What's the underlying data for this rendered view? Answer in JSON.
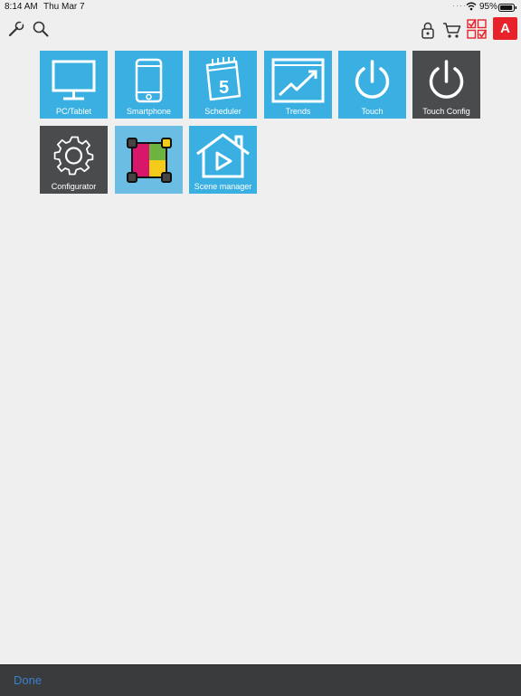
{
  "status_bar": {
    "time": "8:14 AM",
    "date": "Thu Mar 7",
    "dots": "····",
    "battery_text": "95%",
    "battery_level": 0.95,
    "wifi_icon": "wifi-icon",
    "battery_icon": "battery-icon"
  },
  "toolbar": {
    "left_icons": [
      "wrench-icon",
      "search-icon"
    ],
    "right_icons": [
      "lock-icon",
      "cart-icon",
      "checklist-icon",
      "account-icon"
    ],
    "account_letter": "A"
  },
  "tiles": [
    {
      "label": "PC/Tablet",
      "icon": "monitor-icon"
    },
    {
      "label": "Smartphone",
      "icon": "smartphone-icon"
    },
    {
      "label": "Scheduler",
      "icon": "calendar-icon",
      "badge": "5"
    },
    {
      "label": "Trends",
      "icon": "trend-chart-icon"
    },
    {
      "label": "Touch",
      "icon": "power-icon"
    },
    {
      "label": "Touch Config",
      "icon": "power-icon"
    },
    {
      "label": "Configurator",
      "icon": "gear-icon"
    },
    {
      "label": "",
      "icon": "color-grid-icon"
    },
    {
      "label": "Scene manager",
      "icon": "home-play-icon"
    }
  ],
  "bottom_bar": {
    "done_label": "Done"
  },
  "colors": {
    "background": "#efeff0",
    "tile_blue": "#3ab0e2",
    "tile_dark": "#4a4b4d",
    "tile_light_blue": "#6cbde3",
    "accent_red": "#e8222a",
    "bottom_bar": "#3a3b3d",
    "link_blue": "#3d7fd0"
  }
}
